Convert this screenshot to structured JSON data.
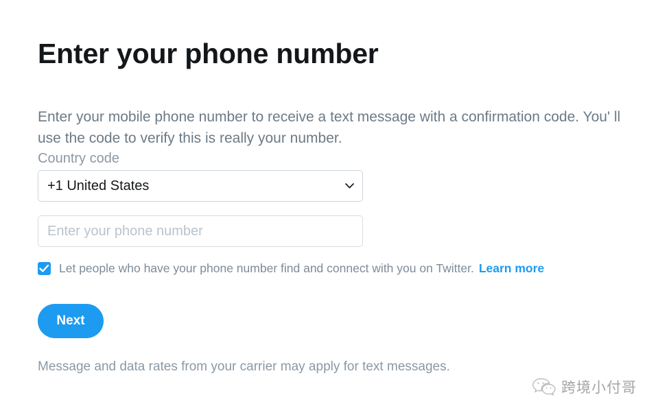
{
  "page": {
    "title": "Enter your phone number",
    "intro": "Enter your mobile phone number to receive a text message with a confirmation code. You'  ll use the code to verify this is really your number.",
    "footer_note": "Message and data rates from your carrier may apply for text messages."
  },
  "country_code": {
    "label": "Country code",
    "selected": "+1 United States",
    "chevron_icon": "chevron-down-icon"
  },
  "phone": {
    "value": "",
    "placeholder": "Enter your phone number"
  },
  "discoverability": {
    "checked": true,
    "checkbox_icon": "check-icon",
    "label": "Let people who have your phone number find and connect with you on Twitter.",
    "link_label": "Learn more"
  },
  "actions": {
    "next_label": "Next"
  },
  "watermark": {
    "icon": "wechat-icon",
    "text": "跨境小付哥"
  },
  "colors": {
    "accent": "#1d9bf0",
    "heading": "#14171a",
    "body_text": "#6b7a87",
    "muted_text": "#8b98a5",
    "placeholder": "#b9c3cc",
    "border": "#ccd6dd",
    "background": "#ffffff"
  }
}
